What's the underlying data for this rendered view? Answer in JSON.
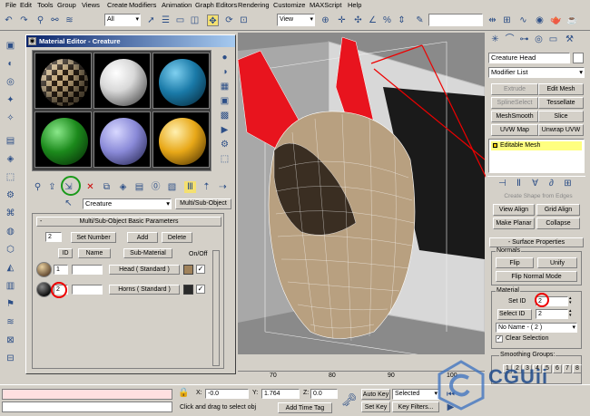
{
  "menus": [
    "File",
    "Edit",
    "Tools",
    "Group",
    "Views",
    "Create",
    "Modifiers",
    "Animation",
    "Graph Editors",
    "Rendering",
    "Customize",
    "MAXScript",
    "Help"
  ],
  "toolbar": {
    "selection_filter": "All",
    "ref_coord": "View"
  },
  "material_editor": {
    "title": "Material Editor - Creature",
    "material_name": "Creature",
    "material_type": "Multi/Sub-Object",
    "rollout_title": "Multi/Sub-Object Basic Parameters",
    "count": "2",
    "set_number_label": "Set Number",
    "add_label": "Add",
    "delete_label": "Delete",
    "headers": {
      "id": "ID",
      "name": "Name",
      "sub_material": "Sub-Material",
      "on_off": "On/Off"
    },
    "rows": [
      {
        "id": "1",
        "name": "",
        "sub_material": "Head  ( Standard )",
        "color": "#a0825a"
      },
      {
        "id": "2",
        "name": "",
        "sub_material": "Horns  ( Standard )",
        "color": "#2a2a2a"
      }
    ],
    "sphere_colors": [
      "checker",
      "#e8e8e8",
      "#1a7aa8",
      "#1c8a1c",
      "#8a8ad8",
      "#e8a818"
    ]
  },
  "right_panel": {
    "object_name": "Creature Head",
    "modifier_list": "Modifier List",
    "buttons": [
      "Extrude",
      "Edit Mesh",
      "SplineSelect",
      "Tessellate",
      "MeshSmooth",
      "Slice",
      "UVW Map",
      "Unwrap UVW"
    ],
    "stack_item": "Editable Mesh",
    "cut_text": "Create Shape from Edges",
    "align_buttons": [
      "View Align",
      "Grid Align",
      "Make Planar",
      "Collapse"
    ],
    "surface_properties": "Surface Properties",
    "normals": "Normals",
    "flip": "Flip",
    "unify": "Unify",
    "flip_normal_mode": "Flip Normal Mode",
    "material": "Material",
    "set_id_label": "Set ID",
    "set_id_value": "2",
    "select_id_label": "Select ID",
    "select_id_value": "2",
    "no_name": "No Name - ( 2 )",
    "clear_selection": "Clear Selection",
    "smoothing_groups": "Smoothing Groups:",
    "smoothing": [
      "1",
      "2",
      "3",
      "4",
      "5",
      "6",
      "7",
      "8"
    ]
  },
  "status": {
    "x_label": "X:",
    "x_value": "-0.0",
    "y_label": "Y:",
    "y_value": "1.764",
    "z_label": "Z:",
    "z_value": "0.0",
    "auto_key": "Auto Key",
    "selected": "Selected",
    "set_key": "Set Key",
    "key_filters": "Key Filters...",
    "prompt": "Click and drag to select obj",
    "add_time_tag": "Add Time Tag",
    "timeline_ticks": [
      "70",
      "80",
      "90",
      "100"
    ]
  },
  "watermark": "CGUii"
}
